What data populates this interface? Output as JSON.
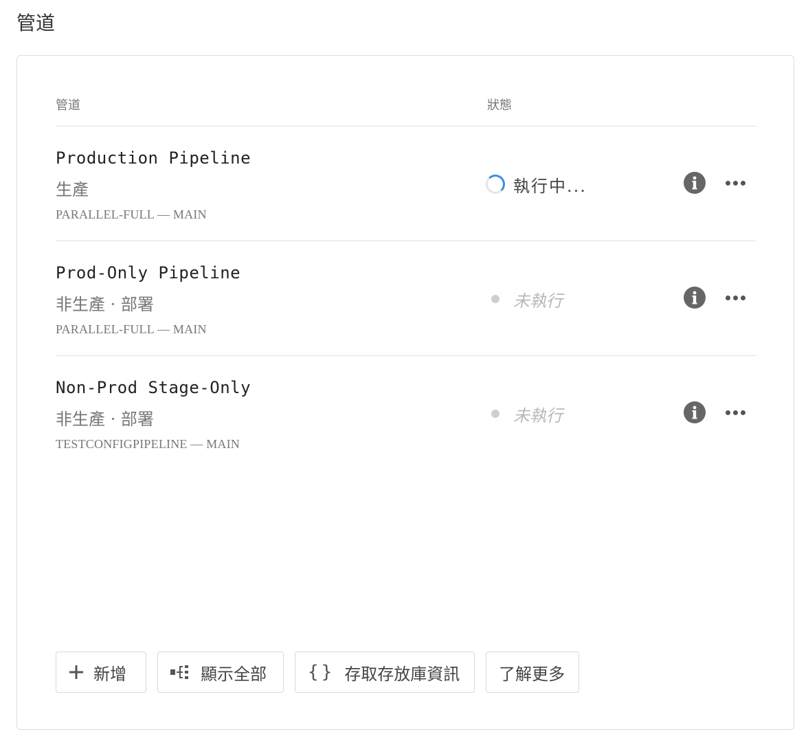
{
  "page": {
    "title": "管道"
  },
  "table": {
    "headers": {
      "name": "管道",
      "status": "狀態"
    },
    "rows": [
      {
        "name": "Production Pipeline",
        "env": "生產",
        "source": "PARALLEL-FULL — MAIN",
        "status_label": "執行中...",
        "status_kind": "running"
      },
      {
        "name": "Prod-Only Pipeline",
        "env": "非生產 · 部署",
        "source": "PARALLEL-FULL — MAIN",
        "status_label": "未執行",
        "status_kind": "idle"
      },
      {
        "name": "Non-Prod Stage-Only",
        "env": "非生產 · 部署",
        "source": "TESTCONFIGPIPELINE — MAIN",
        "status_label": "未執行",
        "status_kind": "idle"
      }
    ]
  },
  "actions": {
    "add": "新增",
    "show_all": "顯示全部",
    "repo_info": "存取存放庫資訊",
    "learn_more": "了解更多"
  },
  "colors": {
    "spinner_accent": "#3a8fe0",
    "idle_dot": "#cfcfcf",
    "icon": "#666666"
  }
}
